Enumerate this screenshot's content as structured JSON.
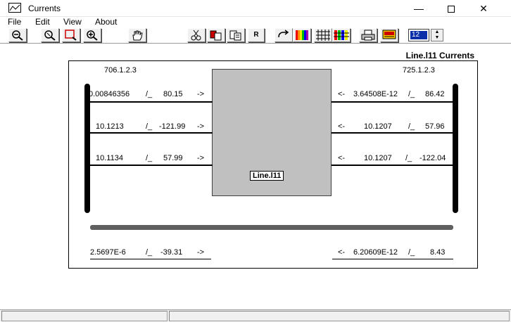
{
  "window": {
    "title": "Currents",
    "minimize": "—",
    "close": "✕"
  },
  "menu": [
    {
      "label": "File"
    },
    {
      "label": "Edit"
    },
    {
      "label": "View"
    },
    {
      "label": "About"
    }
  ],
  "toolbar": {
    "bold_button": "R",
    "zoom_value": "12",
    "spin_up": "▲",
    "spin_down": "▼"
  },
  "diagram": {
    "title": "Line.l11 Currents",
    "left_bus": "706.1.2.3",
    "right_bus": "725.1.2.3",
    "line_label": "Line.l11",
    "left_phases": [
      {
        "magnitude": "0.00846356",
        "angle_sep": "/_",
        "angle": "80.15",
        "arrow": "->"
      },
      {
        "magnitude": "10.1213",
        "angle_sep": "/_",
        "angle": "-121.99",
        "arrow": "->"
      },
      {
        "magnitude": "10.1134",
        "angle_sep": "/_",
        "angle": "57.99",
        "arrow": "->"
      }
    ],
    "right_phases": [
      {
        "arrow": "<-",
        "magnitude": "3.64508E-12",
        "angle_sep": "/_",
        "angle": "86.42"
      },
      {
        "arrow": "<-",
        "magnitude": "10.1207",
        "angle_sep": "/_",
        "angle": "57.96"
      },
      {
        "arrow": "<-",
        "magnitude": "10.1207",
        "angle_sep": "/_",
        "angle": "-122.04"
      }
    ],
    "left_ground": {
      "magnitude": "2.5697E-6",
      "angle_sep": "/_",
      "angle": "-39.31",
      "arrow": "->"
    },
    "right_ground": {
      "arrow": "<-",
      "magnitude": "6.20609E-12",
      "angle_sep": "/_",
      "angle": "8.43"
    }
  }
}
